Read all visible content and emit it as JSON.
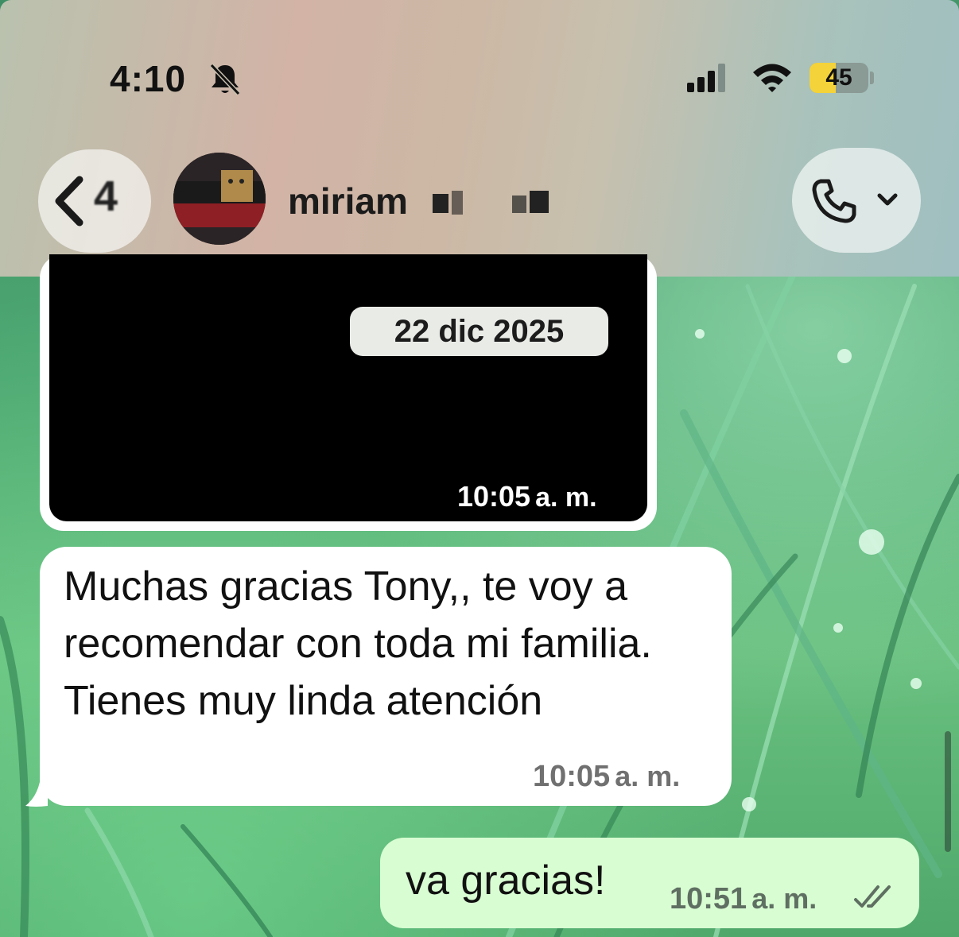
{
  "status_bar": {
    "time": "4:10",
    "battery_label": "45",
    "battery_level_percent": 45
  },
  "header": {
    "back_count": "4",
    "contact_name": "miriam",
    "icons": [
      "back-chevron-icon",
      "bell-muted-icon",
      "signal-icon",
      "wifi-icon",
      "phone-icon",
      "chevron-down-icon"
    ]
  },
  "messages": {
    "media": {
      "date": "22 dic 2025",
      "time": "10:05",
      "ampm": "a. m."
    },
    "incoming": {
      "text": "Muchas gracias Tony,, te voy a recomendar con toda mi familia. Tienes muy linda atención",
      "time": "10:05",
      "ampm": "a. m."
    },
    "outgoing": {
      "text": "va gracias!",
      "time": "10:51",
      "ampm": "a. m."
    }
  },
  "colors": {
    "outgoing_bubble": "#d8fdd2",
    "incoming_bubble": "#ffffff",
    "battery_fill": "#f4d33a"
  }
}
